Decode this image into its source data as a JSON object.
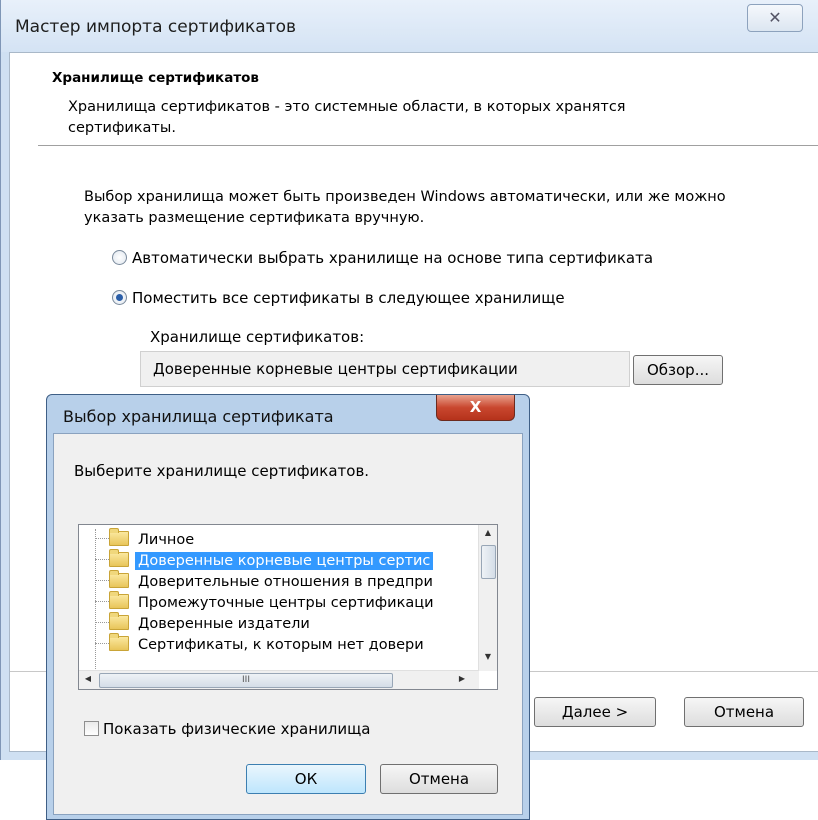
{
  "wizard": {
    "title": "Мастер импорта сертификатов",
    "close_glyph": "✕",
    "header_title": "Хранилище сертификатов",
    "header_desc": "Хранилища сертификатов - это системные области, в которых хранятся сертификаты.",
    "intro": "Выбор хранилища может быть произведен Windows автоматически, или же можно указать размещение сертификата вручную.",
    "radio_auto": "Автоматически выбрать хранилище на основе типа сертификата",
    "radio_manual": "Поместить все сертификаты в следующее хранилище",
    "selected_radio": "manual",
    "store_label": "Хранилище сертификатов:",
    "store_value": "Доверенные корневые центры сертификации",
    "browse_label": "Обзор...",
    "next_label": "Далее >",
    "cancel_label": "Отмена"
  },
  "dialog": {
    "title": "Выбор хранилища сертификата",
    "close_glyph": "X",
    "prompt": "Выберите хранилище сертификатов.",
    "tree_items": [
      {
        "label": "Личное",
        "selected": false
      },
      {
        "label": "Доверенные корневые центры сертис",
        "selected": true
      },
      {
        "label": "Доверительные отношения в предпри",
        "selected": false
      },
      {
        "label": "Промежуточные центры сертификаци",
        "selected": false
      },
      {
        "label": "Доверенные издатели",
        "selected": false
      },
      {
        "label": "Сертификаты, к которым нет довери",
        "selected": false
      }
    ],
    "hscroll_grip": "III",
    "show_physical_label": "Показать физические хранилища",
    "show_physical_checked": false,
    "ok_label": "ОК",
    "cancel_label": "Отмена"
  },
  "colors": {
    "selection": "#3399ff",
    "close_red": "#c9472f",
    "titlebar": "#d4e3f4"
  }
}
